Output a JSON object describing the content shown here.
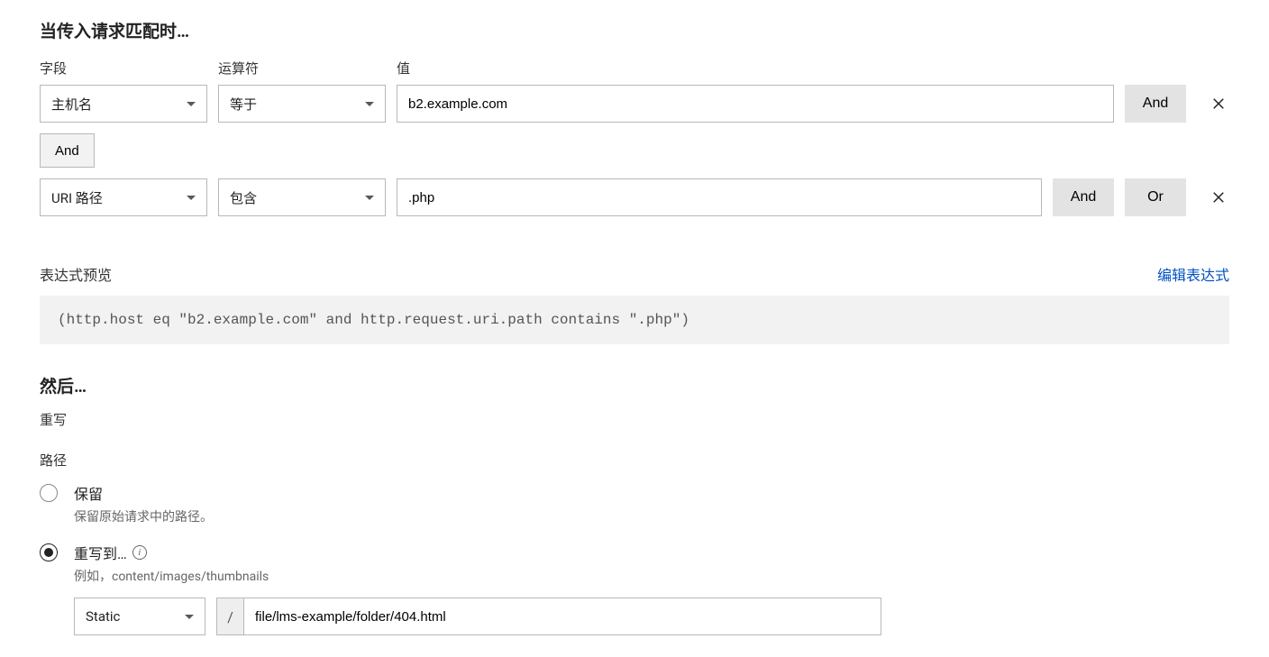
{
  "headings": {
    "when_match": "当传入请求匹配时…",
    "then": "然后…"
  },
  "labels": {
    "field": "字段",
    "operator": "运算符",
    "value": "值",
    "and": "And",
    "or": "Or",
    "preview": "表达式预览",
    "edit_expression": "编辑表达式",
    "rewrite": "重写",
    "path": "路径"
  },
  "rules": [
    {
      "field": "主机名",
      "operator": "等于",
      "value": "b2.example.com"
    },
    {
      "field": "URI 路径",
      "operator": "包含",
      "value": ".php"
    }
  ],
  "expression": "(http.host eq \"b2.example.com\" and http.request.uri.path contains \".php\")",
  "radio": {
    "preserve": {
      "label": "保留",
      "desc": "保留原始请求中的路径。"
    },
    "rewrite_to": {
      "label": "重写到…",
      "desc": "例如，content/images/thumbnails"
    }
  },
  "rewrite": {
    "type": "Static",
    "slash": "/",
    "path": "file/lms-example/folder/404.html"
  }
}
